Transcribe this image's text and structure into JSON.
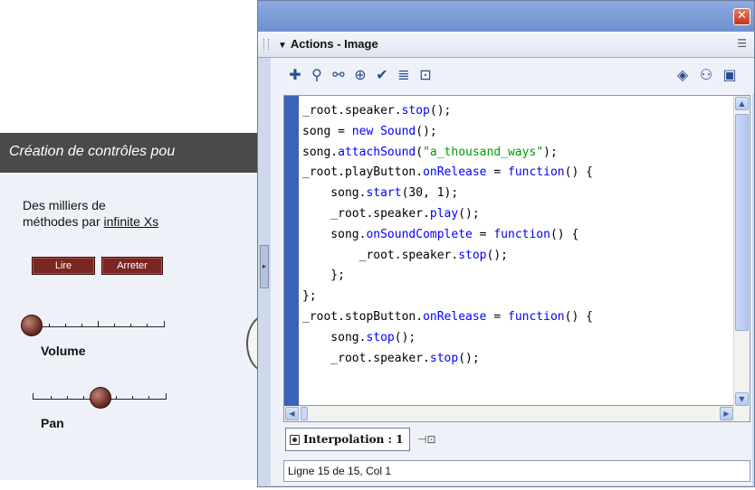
{
  "stage": {
    "banner_title": "Création de contrôles pou",
    "subtitle_line1": "Des milliers de",
    "subtitle_line2_prefix": "méthodes par ",
    "subtitle_link": "infinite Xs",
    "buttons": {
      "play": "Lire",
      "stop": "Arreter"
    },
    "volume_label": "Volume",
    "pan_label": "Pan",
    "volume_level": 0.0,
    "pan_level": 0.5
  },
  "panel": {
    "title": "Actions - Image",
    "toolbar_icons": [
      "add-statement-icon",
      "find-icon",
      "replace-icon",
      "insert-target-path-icon",
      "check-syntax-icon",
      "auto-format-icon",
      "show-code-hint-icon",
      "reference-icon",
      "debug-options-icon",
      "view-options-icon"
    ],
    "code_lines": [
      [
        {
          "t": "_root.speaker."
        },
        {
          "t": "stop",
          "k": "kw"
        },
        {
          "t": "();"
        }
      ],
      [
        {
          "t": "song = "
        },
        {
          "t": "new",
          "k": "kw"
        },
        {
          "t": " "
        },
        {
          "t": "Sound",
          "k": "kw"
        },
        {
          "t": "();"
        }
      ],
      [
        {
          "t": "song."
        },
        {
          "t": "attachSound",
          "k": "kw"
        },
        {
          "t": "("
        },
        {
          "t": "\"a_thousand_ways\"",
          "k": "str"
        },
        {
          "t": ");"
        }
      ],
      [
        {
          "t": "_root.playButton."
        },
        {
          "t": "onRelease",
          "k": "kw"
        },
        {
          "t": " = "
        },
        {
          "t": "function",
          "k": "kw"
        },
        {
          "t": "() {"
        }
      ],
      [
        {
          "t": "    song."
        },
        {
          "t": "start",
          "k": "kw"
        },
        {
          "t": "(30, 1);"
        }
      ],
      [
        {
          "t": "    _root.speaker."
        },
        {
          "t": "play",
          "k": "kw"
        },
        {
          "t": "();"
        }
      ],
      [
        {
          "t": "    song."
        },
        {
          "t": "onSoundComplete",
          "k": "kw"
        },
        {
          "t": " = "
        },
        {
          "t": "function",
          "k": "kw"
        },
        {
          "t": "() {"
        }
      ],
      [
        {
          "t": "        _root.speaker."
        },
        {
          "t": "stop",
          "k": "kw"
        },
        {
          "t": "();"
        }
      ],
      [
        {
          "t": "    };"
        }
      ],
      [
        {
          "t": "};"
        }
      ],
      [
        {
          "t": "_root.stopButton."
        },
        {
          "t": "onRelease",
          "k": "kw"
        },
        {
          "t": " = "
        },
        {
          "t": "function",
          "k": "kw"
        },
        {
          "t": "() {"
        }
      ],
      [
        {
          "t": "    song."
        },
        {
          "t": "stop",
          "k": "kw"
        },
        {
          "t": "();"
        }
      ],
      [
        {
          "t": "    _root.speaker."
        },
        {
          "t": "stop",
          "k": "kw"
        },
        {
          "t": "();"
        }
      ]
    ],
    "tab_label": "Interpolation : 1",
    "status": "Ligne 15 de 15, Col 1"
  },
  "colors": {
    "keyword": "#0000ff",
    "string": "#009900",
    "gutter": "#3a63b7",
    "stage_button": "#7a2622"
  }
}
